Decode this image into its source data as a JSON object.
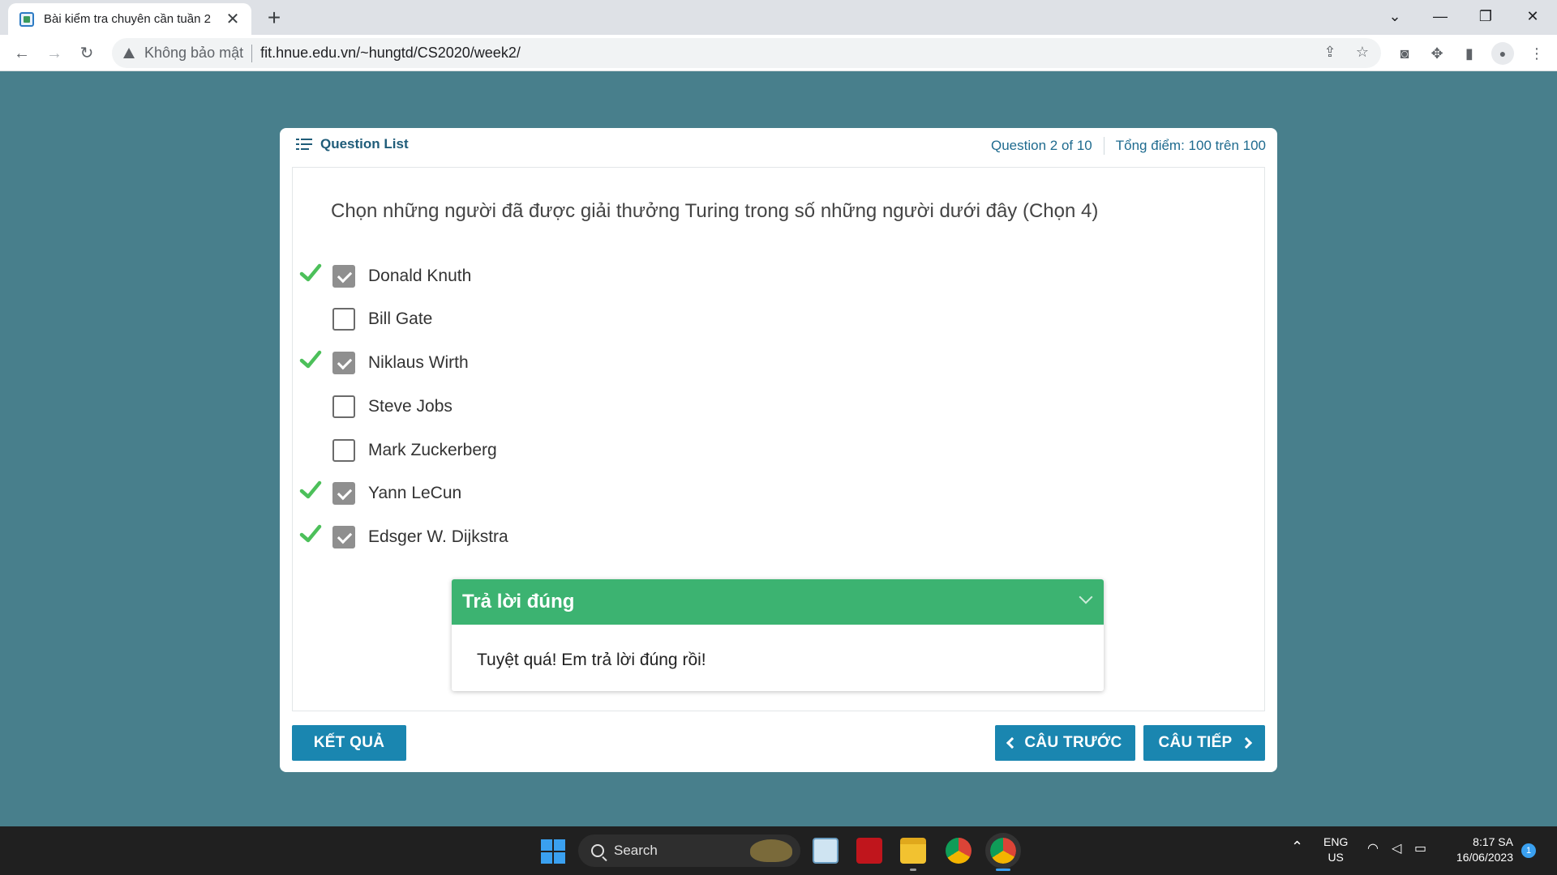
{
  "browser": {
    "tab_title": "Bài kiểm tra chuyên cần tuần 2",
    "tab_close": "✕",
    "new_tab": "+",
    "security_text": "Không bảo mật",
    "url": "fit.hnue.edu.vn/~hungtd/CS2020/week2/"
  },
  "quiz": {
    "question_list_label": "Question List",
    "question_counter": "Question 2 of 10",
    "score_text": "Tổng điểm: 100 trên 100",
    "question_text": "Chọn những người đã được giải thưởng Turing trong số những người dưới đây (Chọn 4)",
    "options": [
      {
        "label": "Donald Knuth",
        "checked": true,
        "correct_mark": true
      },
      {
        "label": "Bill Gate",
        "checked": false,
        "correct_mark": false
      },
      {
        "label": "Niklaus Wirth",
        "checked": true,
        "correct_mark": true
      },
      {
        "label": "Steve Jobs",
        "checked": false,
        "correct_mark": false
      },
      {
        "label": "Mark Zuckerberg",
        "checked": false,
        "correct_mark": false
      },
      {
        "label": "Yann LeCun",
        "checked": true,
        "correct_mark": true
      },
      {
        "label": "Edsger W. Dijkstra",
        "checked": true,
        "correct_mark": true
      }
    ],
    "feedback": {
      "title": "Trả lời đúng",
      "body": "Tuyệt quá! Em trả lời đúng rồi!"
    },
    "buttons": {
      "result": "KẾT QUẢ",
      "previous": "CÂU TRƯỚC",
      "next": "CÂU TIẾP"
    }
  },
  "taskbar": {
    "search_label": "Search",
    "language_line1": "ENG",
    "language_line2": "US",
    "time": "8:17 SA",
    "date": "16/06/2023",
    "notification_count": "1"
  },
  "colors": {
    "page_background": "#487f8c",
    "accent_blue": "#1a86b0",
    "correct_green": "#3cb371",
    "tick_green": "#4cc05a"
  }
}
